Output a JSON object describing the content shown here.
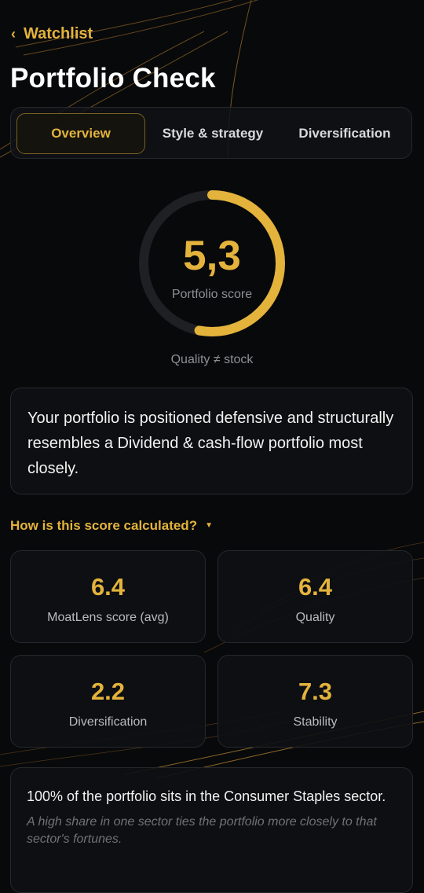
{
  "nav": {
    "back_label": "Watchlist"
  },
  "page": {
    "title": "Portfolio Check"
  },
  "tabs": [
    {
      "label": "Overview",
      "active": true
    },
    {
      "label": "Style & strategy",
      "active": false
    },
    {
      "label": "Diversification",
      "active": false
    }
  ],
  "score": {
    "value": "5,3",
    "label": "Portfolio score",
    "caption": "Quality ≠ stock",
    "fraction": 0.53
  },
  "summary": {
    "text": "Your portfolio is positioned defensive and structurally resembles a Dividend & cash-flow portfolio most closely."
  },
  "calculation": {
    "label": "How is this score calculated?"
  },
  "metrics": [
    {
      "value": "6.4",
      "label": "MoatLens score (avg)"
    },
    {
      "value": "6.4",
      "label": "Quality"
    },
    {
      "value": "2.2",
      "label": "Diversification"
    },
    {
      "value": "7.3",
      "label": "Stability"
    }
  ],
  "sector_note": {
    "main": "100% of the portfolio sits in the Consumer Staples sector.",
    "detail": "A high share in one sector ties the portfolio more closely to that sector's fortunes."
  },
  "colors": {
    "accent": "#e3b33c",
    "background": "#08090b",
    "card": "#0f1013",
    "track": "#1f2023"
  }
}
